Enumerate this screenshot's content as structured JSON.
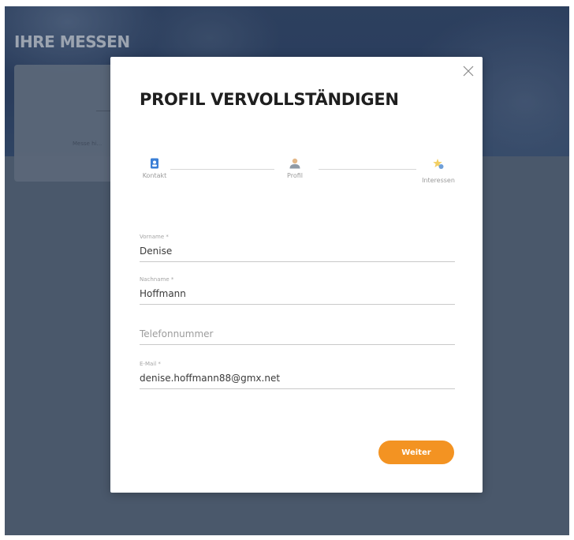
{
  "page": {
    "title": "IHRE MESSEN"
  },
  "background_card": {
    "label": "Messe hi..."
  },
  "modal": {
    "title": "PROFIL VERVOLLSTÄNDIGEN",
    "close_icon": "close-icon",
    "steps": [
      {
        "label": "Kontakt",
        "icon": "contact-card-icon",
        "active": true
      },
      {
        "label": "Profil",
        "icon": "person-icon",
        "active": false
      },
      {
        "label": "Interessen",
        "icon": "star-icon",
        "active": false
      }
    ],
    "fields": {
      "vorname": {
        "label": "Vorname *",
        "value": "Denise"
      },
      "nachname": {
        "label": "Nachname *",
        "value": "Hoffmann"
      },
      "telefon": {
        "label": "",
        "value": "",
        "placeholder": "Telefonnummer"
      },
      "email": {
        "label": "E-Mail *",
        "value": "denise.hoffmann88@gmx.net"
      }
    },
    "next_button": {
      "label": "Weiter"
    }
  },
  "colors": {
    "accent": "#f39322",
    "active_step": "#3b7fd6"
  }
}
